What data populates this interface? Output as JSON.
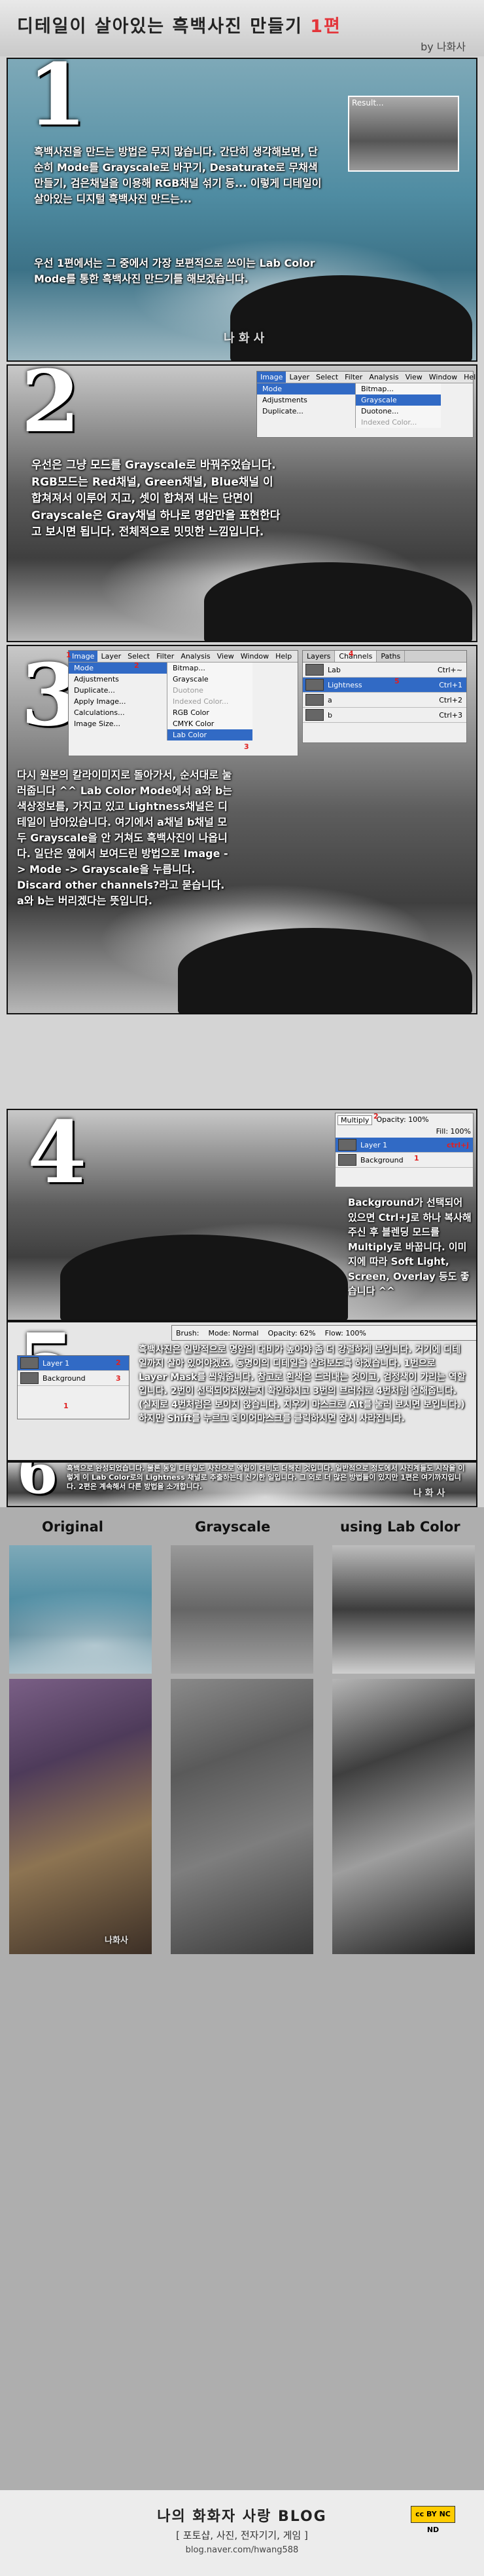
{
  "header": {
    "title": "디테일이 살아있는 흑백사진 만들기 ",
    "part": "1편",
    "author": "by 나화사"
  },
  "step1": {
    "number": "1",
    "result_label": "Result...",
    "text1": "흑백사진을 만드는 방법은 무지 많습니다. 간단히 생각해보면, 단순히 Mode를 Grayscale로 바꾸기, Desaturate로 무채색 만들기, 검은채널을 이용해 RGB채널 섞기 등... 이렇게 디테일이 살아있는 디지털 흑백사진 만드는...",
    "text2": "우선 1편에서는 그 중에서 가장 보편적으로 쓰이는 Lab Color Mode를 통한 흑백사진 만드기를 해보겠습니다.",
    "watermark": "나 화 사"
  },
  "step2": {
    "number": "2",
    "text": "우선은 그냥 모드를 Grayscale로 바꿔주었습니다. RGB모드는 Red채널, Green채널, Blue채널 이 합쳐져서 이루어 지고, 셋이 합쳐져 내는 단면이 Grayscale은 Gray채널 하나로 명암만을 표현한다고 보시면 됩니다. 전체적으로 밋밋한 느낌입니다.",
    "menubar": [
      "Image",
      "Layer",
      "Select",
      "Filter",
      "Analysis",
      "View",
      "Window",
      "Help"
    ],
    "menu_mode": "Mode",
    "menu_adjustments": "Adjustments",
    "menu_duplicate": "Duplicate...",
    "submenu": [
      "Bitmap...",
      "Grayscale",
      "Duotone...",
      "Indexed Color..."
    ]
  },
  "step3": {
    "number": "3",
    "menubar": [
      "Image",
      "Layer",
      "Select",
      "Filter",
      "Analysis",
      "View",
      "Window",
      "Help"
    ],
    "menu_items": [
      "Mode",
      "Adjustments",
      "Duplicate...",
      "Apply Image...",
      "Calculations...",
      "Image Size..."
    ],
    "submenu": [
      "Bitmap...",
      "Grayscale",
      "Duotone",
      "Indexed Color...",
      "RGB Color",
      "CMYK Color",
      "Lab Color"
    ],
    "panel_tabs": [
      "Layers",
      "Channels",
      "Paths"
    ],
    "channels": [
      {
        "name": "Lab",
        "shortcut": "Ctrl+~"
      },
      {
        "name": "Lightness",
        "shortcut": "Ctrl+1"
      },
      {
        "name": "a",
        "shortcut": "Ctrl+2"
      },
      {
        "name": "b",
        "shortcut": "Ctrl+3"
      }
    ],
    "marks": [
      "1",
      "2",
      "3",
      "4",
      "5"
    ],
    "text": "다시 원본의 칼라이미지로 돌아가서, 순서대로 눌러줍니다 ^^ Lab Color Mode에서 a와 b는 색상정보를, 가지고 있고 Lightness채널은 디테일이 남아있습니다. 여기에서 a채널 b채널 모두 Grayscale을 안 거쳐도 흑백사진이 나옵니다. 일단은 옆에서 보여드린 방법으로 Image -> Mode -> Grayscale을 누릅니다. Discard other channels?라고 묻습니다. a와 b는 버리겠다는 뜻입니다."
  },
  "step4": {
    "number": "4",
    "mode": "Multiply",
    "opacity_label": "Opacity: 100%",
    "fill_label": "Fill: 100%",
    "layers": [
      {
        "name": "Layer 1",
        "shortcut": "ctrl+j"
      },
      {
        "name": "Background",
        "shortcut": ""
      }
    ],
    "marks": [
      "1",
      "2"
    ],
    "text": "Background가 선택되어 있으면 Ctrl+J로 하나 복사해주신 후 블렌딩 모드를 Multiply로 바꿉니다. 이미지에 따라 Soft Light, Screen, Overlay 등도 좋습니다 ^^"
  },
  "step5": {
    "number": "5",
    "brush_label": "Brush:",
    "mode_label": "Mode: Normal",
    "opacity_label": "Opacity: 62%",
    "flow_label": "Flow: 100%",
    "layers": [
      {
        "name": "Layer 1"
      },
      {
        "name": "Background"
      }
    ],
    "marks": [
      "1",
      "2",
      "3"
    ],
    "text": "흑백사진은 일반적으로 명암의 대비가 높아야 좀 더 강렬하게 보입니다. 거기에 디테일까지 살아 있어야겠죠. 동명이의 디테일을 살려보도록 하겠습니다. 1번으로 Layer Mask를 씌워줍니다. 참고로 흰색은 드러내는 것이고, 검정색이 가리는 역할입니다. 2번이 선택되어져있는지 확인하시고 3번의 브러쉬로 4번처럼 칠해줍니다. (실제로 4번처럼은 보이지 않습니다. 지우기 마스크로 Alt를 눌러 보시면 보입니다.) 하지만 Shift를 누르고 레이어마스크를 클릭하시면 잠시 사라집니다."
  },
  "step6": {
    "number": "6",
    "text": "흑백으로 완성되었습니다. 물론 동일 디테일도 사진으로 엑일이 대비도 더해진 것입니다. 일반적으로 정도에서 사진계들도 시작을 이렇게 이 Lab Color로의 Lightness 채널로 추출하는데 신기한 일입니다. 그 외로 더 많은 방법들이 있지만 1편은 여기까지입니다. 2편은 계속해서 다른 방법을 소개합니다.",
    "watermark": "나 화 사"
  },
  "compare": {
    "labels": [
      "Original",
      "Grayscale",
      "using Lab Color"
    ],
    "watermark": "나화사"
  },
  "footer": {
    "blog_name": "나의 화화자 사랑 BLOG",
    "subtitle": "[ 포토샵, 사진, 전자기기, 게임 ]",
    "url": "blog.naver.com/hwang588",
    "badge": "cc BY NC ND"
  }
}
